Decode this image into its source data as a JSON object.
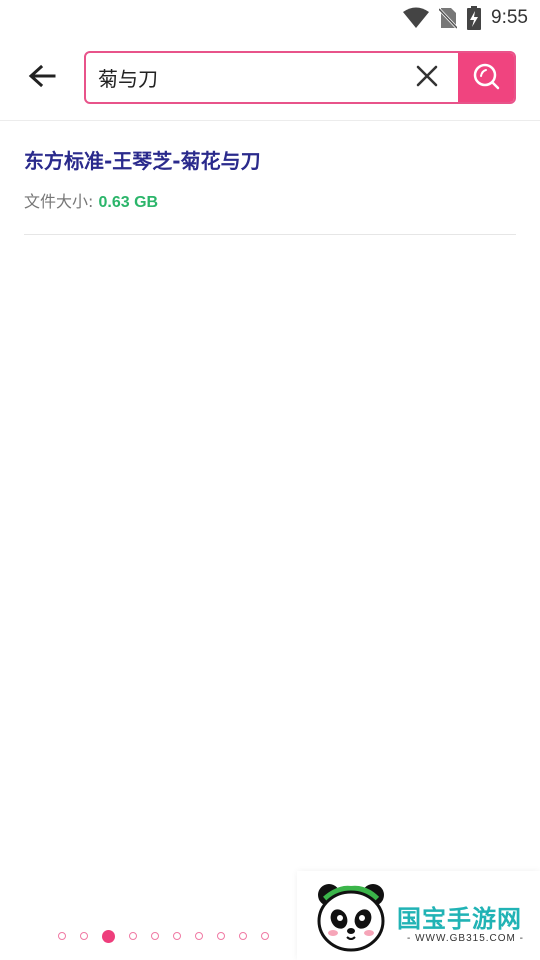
{
  "status_bar": {
    "time": "9:55",
    "icons": [
      "wifi-icon",
      "no-sim-icon",
      "battery-charging-icon"
    ]
  },
  "search": {
    "value": "菊与刀",
    "back_icon": "arrow-left-icon",
    "clear_icon": "close-icon",
    "submit_icon": "search-icon",
    "accent_color": "#f0447f"
  },
  "results": [
    {
      "title": "东方标准-王琴芝-菊花与刀",
      "size_label": "文件大小:",
      "size_value": "0.63 GB"
    }
  ],
  "pagination": {
    "total": 10,
    "active_index": 2
  },
  "watermark": {
    "title": "国宝手游网",
    "subtitle": "- WWW.GB315.COM -"
  }
}
